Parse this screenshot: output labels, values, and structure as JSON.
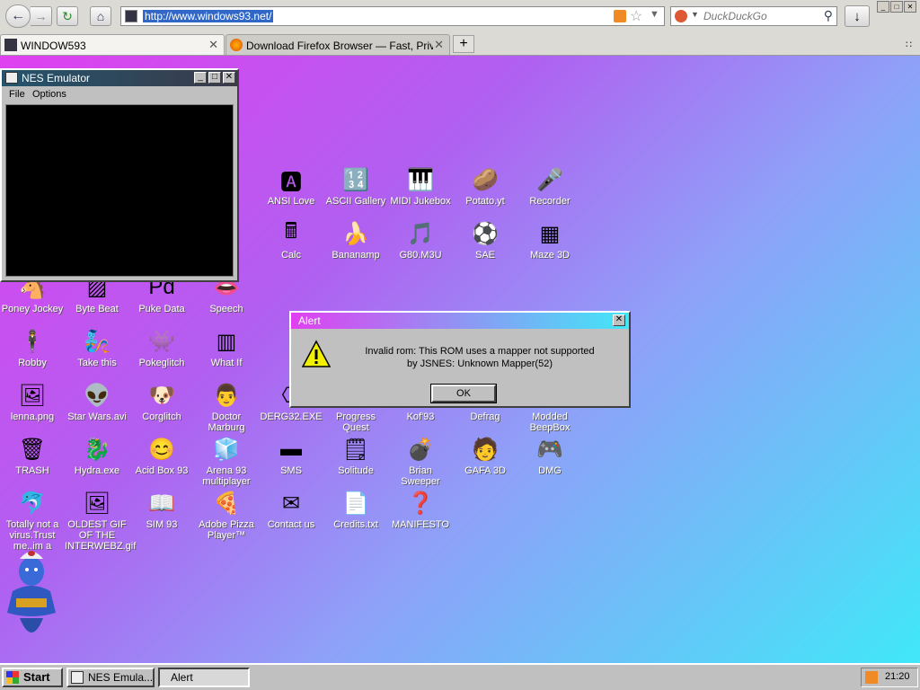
{
  "browser": {
    "url": "http://www.windows93.net/",
    "search_placeholder": "DuckDuckGo",
    "tabs": [
      {
        "label": "WINDOW593"
      },
      {
        "label": "Download Firefox Browser — Fast, Privat..."
      }
    ]
  },
  "desktop": {
    "icons": [
      {
        "label": "ANSI Love",
        "glyph": "🅰"
      },
      {
        "label": "ASCII Gallery",
        "glyph": "🔢"
      },
      {
        "label": "MIDI Jukebox",
        "glyph": "🎹"
      },
      {
        "label": "Potato.yt",
        "glyph": "🥔"
      },
      {
        "label": "Recorder",
        "glyph": "🎤"
      },
      {
        "label": "Calc",
        "glyph": "🖩"
      },
      {
        "label": "Bananamp",
        "glyph": "🍌"
      },
      {
        "label": "G80.M3U",
        "glyph": "🎵"
      },
      {
        "label": "SAE",
        "glyph": "⚽"
      },
      {
        "label": "Maze 3D",
        "glyph": "▦"
      },
      {
        "label": "Poney Jockey",
        "glyph": "🐴"
      },
      {
        "label": "Byte Beat",
        "glyph": "▨"
      },
      {
        "label": "Puke Data",
        "glyph": "Pd"
      },
      {
        "label": "Speech",
        "glyph": "👄"
      },
      {
        "label": "Robby",
        "glyph": "🕴"
      },
      {
        "label": "Take this",
        "glyph": "🧞"
      },
      {
        "label": "Pokeglitch",
        "glyph": "👾"
      },
      {
        "label": "What If",
        "glyph": "▥"
      },
      {
        "label": "lenna.png",
        "glyph": "🖼"
      },
      {
        "label": "Star Wars.avi",
        "glyph": "👽"
      },
      {
        "label": "Corglitch",
        "glyph": "🐶"
      },
      {
        "label": "Doctor Marburg",
        "glyph": "👨"
      },
      {
        "label": "DERG32.EXE",
        "glyph": "⎔"
      },
      {
        "label": "Progress Quest",
        "glyph": "📜"
      },
      {
        "label": "Kof'93",
        "glyph": "🥊"
      },
      {
        "label": "Defrag",
        "glyph": "▤"
      },
      {
        "label": "Modded BeepBox",
        "glyph": "🎚"
      },
      {
        "label": "TRASH",
        "glyph": "🗑"
      },
      {
        "label": "Hydra.exe",
        "glyph": "🐉"
      },
      {
        "label": "Acid Box 93",
        "glyph": "😊"
      },
      {
        "label": "Arena 93 multiplayer",
        "glyph": "🧊"
      },
      {
        "label": "SMS",
        "glyph": "▬"
      },
      {
        "label": "Solitude",
        "glyph": "🗒"
      },
      {
        "label": "Brian Sweeper",
        "glyph": "💣"
      },
      {
        "label": "GAFA 3D",
        "glyph": "🧑"
      },
      {
        "label": "DMG",
        "glyph": "🎮"
      },
      {
        "label": "Totally not a virus.Trust me..im a",
        "glyph": "🐬"
      },
      {
        "label": "OLDEST GIF OF THE INTERWEBZ.gif",
        "glyph": "🖼"
      },
      {
        "label": "SIM 93",
        "glyph": "📖"
      },
      {
        "label": "Adobe Pizza Player™",
        "glyph": "🍕"
      },
      {
        "label": "Contact us",
        "glyph": "✉"
      },
      {
        "label": "Credits.txt",
        "glyph": "📄"
      },
      {
        "label": "MANIFESTO",
        "glyph": "❓"
      }
    ]
  },
  "nes_window": {
    "title": "NES Emulator",
    "menu": [
      "File",
      "Options"
    ]
  },
  "alert_window": {
    "title": "Alert",
    "message_line1": "Invalid rom: This ROM uses a mapper not supported",
    "message_line2": "by JSNES: Unknown Mapper(52)",
    "ok_label": "OK"
  },
  "taskbar": {
    "start_label": "Start",
    "tasks": [
      "NES Emula...",
      "Alert"
    ],
    "clock": "21:20"
  }
}
